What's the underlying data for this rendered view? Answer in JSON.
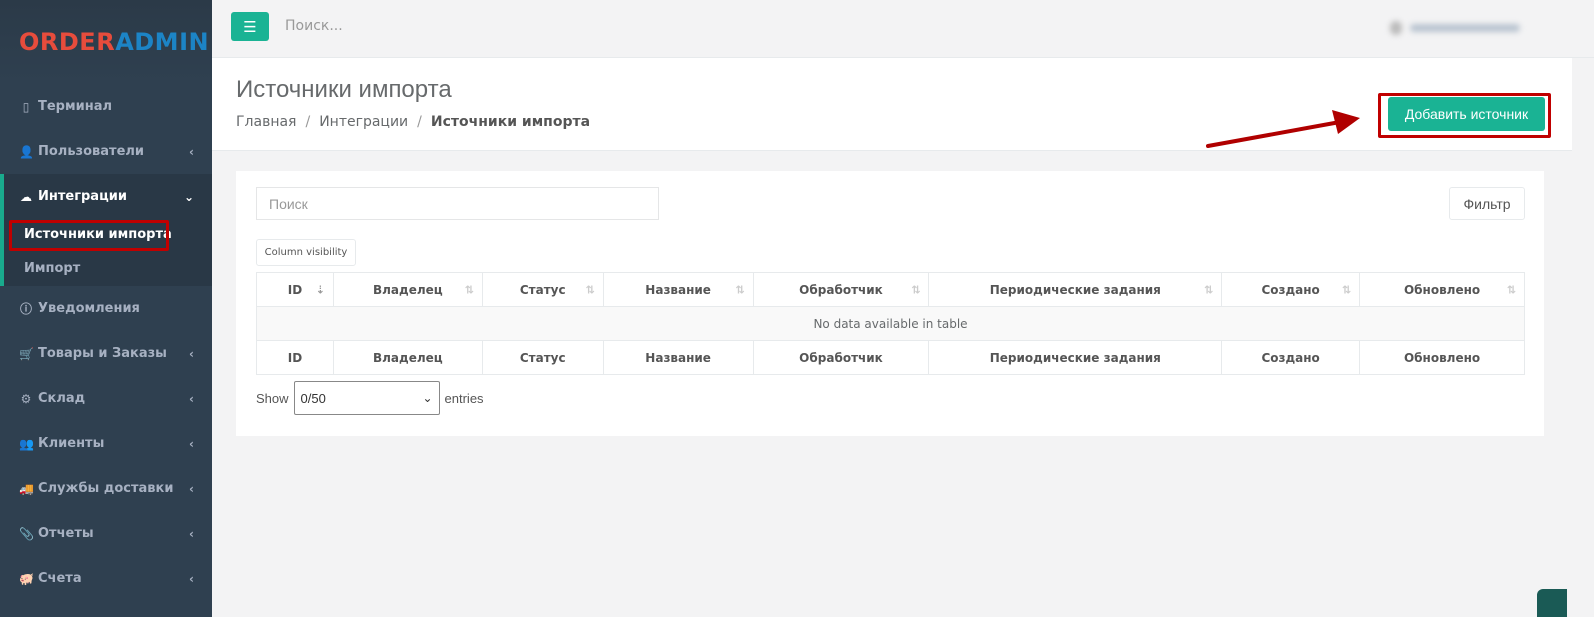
{
  "brand": {
    "part1": "ORDER",
    "part2": "ADMIN"
  },
  "sidebar": {
    "items_top": [
      {
        "icon": "mobile-icon",
        "glyph": "▯",
        "label": "Терминал"
      },
      {
        "icon": "user-icon",
        "glyph": "👤",
        "label": "Пользователи",
        "arrow": "‹"
      }
    ],
    "group": {
      "icon": "cloud-icon",
      "glyph": "☁",
      "label": "Интеграции",
      "arrow": "⌄",
      "children": [
        {
          "label": "Источники импорта",
          "active": true
        },
        {
          "label": "Импорт"
        }
      ]
    },
    "items_bottom": [
      {
        "icon": "info-icon",
        "glyph": "ⓘ",
        "label": "Уведомления"
      },
      {
        "icon": "cart-icon",
        "glyph": "🛒",
        "label": "Товары и Заказы",
        "arrow": "‹"
      },
      {
        "icon": "cubes-icon",
        "glyph": "⚙",
        "label": "Склад",
        "arrow": "‹"
      },
      {
        "icon": "users-icon",
        "glyph": "👥",
        "label": "Клиенты",
        "arrow": "‹"
      },
      {
        "icon": "truck-icon",
        "glyph": "🚚",
        "label": "Службы доставки",
        "arrow": "‹"
      },
      {
        "icon": "paperclip-icon",
        "glyph": "📎",
        "label": "Отчеты",
        "arrow": "‹"
      },
      {
        "icon": "piggy-bank-icon",
        "glyph": "🐖",
        "label": "Счета",
        "arrow": "‹"
      }
    ]
  },
  "topbar": {
    "search_placeholder": "Поиск..."
  },
  "heading": {
    "title": "Источники импорта",
    "breadcrumb": [
      "Главная",
      "Интеграции",
      "Источники импорта"
    ],
    "add_button": "Добавить источник"
  },
  "table_section": {
    "search_placeholder": "Поиск",
    "filter_button": "Фильтр",
    "column_visibility": "Column visibility",
    "columns": [
      "ID",
      "Владелец",
      "Статус",
      "Название",
      "Обработчик",
      "Периодические задания",
      "Создано",
      "Обновлено"
    ],
    "empty_text": "No data available in table",
    "show_label": "Show",
    "entries_value": "0/50",
    "entries_label": "entries"
  }
}
